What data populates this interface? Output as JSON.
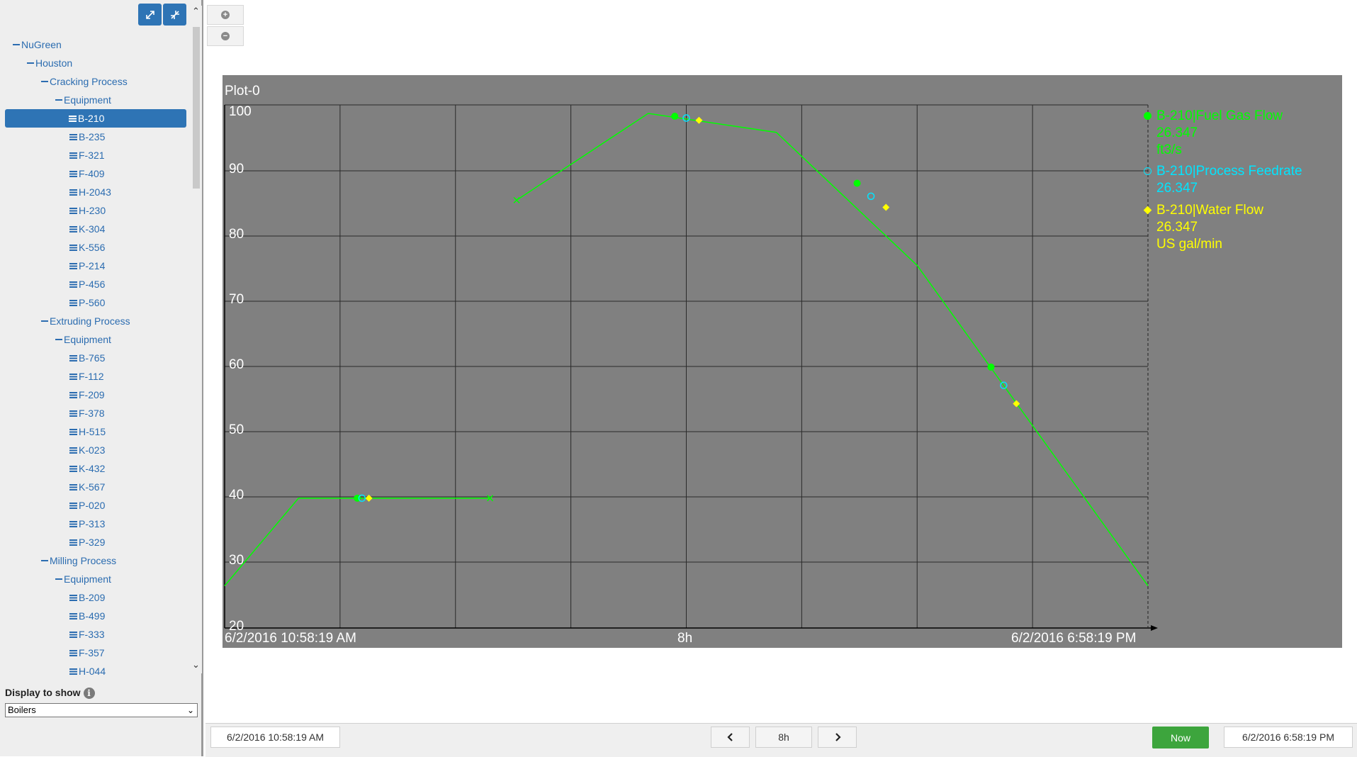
{
  "sidebar": {
    "expand_icon": "expand-arrows-icon",
    "collapse_icon": "collapse-arrows-icon",
    "tree": [
      {
        "label": "NuGreen",
        "kind": "branch",
        "level": 0
      },
      {
        "label": "Houston",
        "kind": "branch",
        "level": 1
      },
      {
        "label": "Cracking Process",
        "kind": "branch",
        "level": 2
      },
      {
        "label": "Equipment",
        "kind": "branch",
        "level": 3
      },
      {
        "label": "B-210",
        "kind": "leaf",
        "level": 4,
        "selected": true
      },
      {
        "label": "B-235",
        "kind": "leaf",
        "level": 4
      },
      {
        "label": "F-321",
        "kind": "leaf",
        "level": 4
      },
      {
        "label": "F-409",
        "kind": "leaf",
        "level": 4
      },
      {
        "label": "H-2043",
        "kind": "leaf",
        "level": 4
      },
      {
        "label": "H-230",
        "kind": "leaf",
        "level": 4
      },
      {
        "label": "K-304",
        "kind": "leaf",
        "level": 4
      },
      {
        "label": "K-556",
        "kind": "leaf",
        "level": 4
      },
      {
        "label": "P-214",
        "kind": "leaf",
        "level": 4
      },
      {
        "label": "P-456",
        "kind": "leaf",
        "level": 4
      },
      {
        "label": "P-560",
        "kind": "leaf",
        "level": 4
      },
      {
        "label": "Extruding Process",
        "kind": "branch",
        "level": 2
      },
      {
        "label": "Equipment",
        "kind": "branch",
        "level": 3
      },
      {
        "label": "B-765",
        "kind": "leaf",
        "level": 4
      },
      {
        "label": "F-112",
        "kind": "leaf",
        "level": 4
      },
      {
        "label": "F-209",
        "kind": "leaf",
        "level": 4
      },
      {
        "label": "F-378",
        "kind": "leaf",
        "level": 4
      },
      {
        "label": "H-515",
        "kind": "leaf",
        "level": 4
      },
      {
        "label": "K-023",
        "kind": "leaf",
        "level": 4
      },
      {
        "label": "K-432",
        "kind": "leaf",
        "level": 4
      },
      {
        "label": "K-567",
        "kind": "leaf",
        "level": 4
      },
      {
        "label": "P-020",
        "kind": "leaf",
        "level": 4
      },
      {
        "label": "P-313",
        "kind": "leaf",
        "level": 4
      },
      {
        "label": "P-329",
        "kind": "leaf",
        "level": 4
      },
      {
        "label": "Milling Process",
        "kind": "branch",
        "level": 2
      },
      {
        "label": "Equipment",
        "kind": "branch",
        "level": 3
      },
      {
        "label": "B-209",
        "kind": "leaf",
        "level": 4
      },
      {
        "label": "B-499",
        "kind": "leaf",
        "level": 4
      },
      {
        "label": "F-333",
        "kind": "leaf",
        "level": 4
      },
      {
        "label": "F-357",
        "kind": "leaf",
        "level": 4
      },
      {
        "label": "H-044",
        "kind": "leaf",
        "level": 4
      }
    ],
    "display_label": "Display to show",
    "display_value": "Boilers"
  },
  "toolbar": {
    "zoom_in_icon": "zoom-in-icon",
    "zoom_out_icon": "zoom-out-icon"
  },
  "plot": {
    "title": "Plot-0",
    "x_start_label": "6/2/2016 10:58:19 AM",
    "x_mid_label": "8h",
    "x_end_label": "6/2/2016 6:58:19 PM",
    "colors": {
      "background": "#808080",
      "grid": "#2a2a2a",
      "fuel": "#00ff00",
      "feed": "#00e5ff",
      "water": "#ffff00"
    },
    "legend": [
      {
        "name": "B-210|Fuel Gas Flow",
        "value": "26.347",
        "unit": "ft3/s",
        "color": "#00ff00",
        "marker": "filled-circle"
      },
      {
        "name": "B-210|Process Feedrate",
        "value": "26.347",
        "unit": "",
        "color": "#00e5ff",
        "marker": "open-circle"
      },
      {
        "name": "B-210|Water Flow",
        "value": "26.347",
        "unit": "US gal/min",
        "color": "#ffff00",
        "marker": "diamond"
      }
    ]
  },
  "chart_data": {
    "type": "line",
    "title": "Plot-0",
    "x_unit": "hours after 6/2/2016 10:58:19 AM",
    "xlim": [
      0,
      8
    ],
    "ylim": [
      20,
      100
    ],
    "yticks": [
      100,
      90,
      80,
      70,
      60,
      50,
      40,
      30,
      20
    ],
    "grid": true,
    "legend_position": "right",
    "series": [
      {
        "name": "B-210|Fuel Gas Flow",
        "segments": [
          [
            [
              0.0,
              26.4
            ],
            [
              0.64,
              39.8
            ],
            [
              1.15,
              39.8
            ],
            [
              2.3,
              39.8
            ]
          ],
          [
            [
              2.53,
              85.5
            ],
            [
              3.67,
              100
            ],
            [
              4.78,
              96.7
            ],
            [
              6.0,
              75.5
            ],
            [
              8.0,
              26.4
            ]
          ]
        ],
        "markers": [
          [
            1.15,
            39.8
          ],
          [
            3.9,
            99.5
          ],
          [
            5.48,
            88.1
          ],
          [
            6.64,
            59.9
          ]
        ],
        "x_markers": [
          [
            2.3,
            39.8
          ],
          [
            2.53,
            85.5
          ]
        ]
      },
      {
        "name": "B-210|Process Feedrate",
        "markers": [
          [
            1.19,
            39.8
          ],
          [
            4.0,
            99.2
          ],
          [
            5.6,
            86.1
          ],
          [
            6.75,
            57.1
          ]
        ]
      },
      {
        "name": "B-210|Water Flow",
        "markers": [
          [
            1.25,
            39.8
          ],
          [
            4.11,
            98.8
          ],
          [
            5.73,
            84.4
          ],
          [
            6.86,
            54.3
          ]
        ]
      }
    ]
  },
  "bottom_bar": {
    "start_time": "6/2/2016 10:58:19 AM",
    "duration": "8h",
    "prev_icon": "chevron-left-icon",
    "next_icon": "chevron-right-icon",
    "now_label": "Now",
    "end_time": "6/2/2016 6:58:19 PM"
  }
}
